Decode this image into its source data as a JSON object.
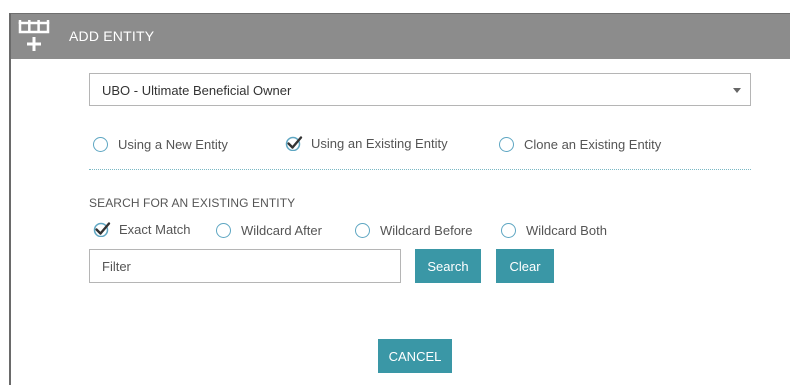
{
  "header": {
    "title": "ADD ENTITY",
    "icon": "add-entity-icon"
  },
  "entity_type": {
    "selected": "UBO - Ultimate Beneficial Owner"
  },
  "mode": {
    "options": [
      {
        "label": "Using a New Entity",
        "selected": false
      },
      {
        "label": "Using an Existing Entity",
        "selected": true
      },
      {
        "label": "Clone an Existing Entity",
        "selected": false
      }
    ]
  },
  "search": {
    "heading": "SEARCH FOR AN EXISTING ENTITY",
    "match_options": [
      {
        "label": "Exact Match",
        "selected": true
      },
      {
        "label": "Wildcard After",
        "selected": false
      },
      {
        "label": "Wildcard Before",
        "selected": false
      },
      {
        "label": "Wildcard Both",
        "selected": false
      }
    ],
    "filter_placeholder": "Filter",
    "filter_value": "",
    "search_label": "Search",
    "clear_label": "Clear"
  },
  "footer": {
    "cancel_label": "CANCEL"
  },
  "colors": {
    "header_bg": "#8c8c8c",
    "accent": "#3a97a6",
    "radio_border": "#5ea6c2"
  }
}
